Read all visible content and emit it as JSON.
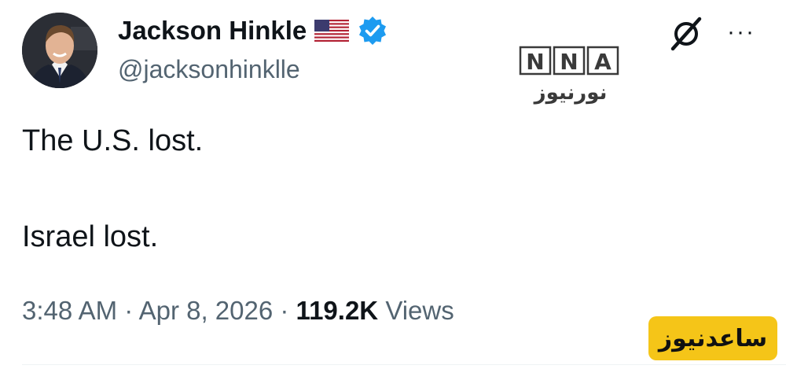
{
  "tweet": {
    "author": {
      "name": "Jackson Hinkle",
      "handle": "@jacksonhinklle"
    },
    "lines": [
      "The U.S. lost.",
      "Israel lost."
    ],
    "meta": {
      "time": "3:48 AM",
      "separator": " · ",
      "date": "Apr 8, 2026",
      "views_count": "119.2K",
      "views_label": "Views"
    }
  },
  "icons": {
    "flag": "us-flag-icon",
    "verified": "verified-badge-icon",
    "grok": "grok-icon",
    "more": "more-icon"
  },
  "more_glyph": "···",
  "watermarks": {
    "nna_text": "NNA",
    "corner_badge": "ساعدنیوز"
  },
  "colors": {
    "text": "#0f1419",
    "secondary": "#536471",
    "verified": "#1d9bf0",
    "badge_bg": "#f5c518"
  }
}
